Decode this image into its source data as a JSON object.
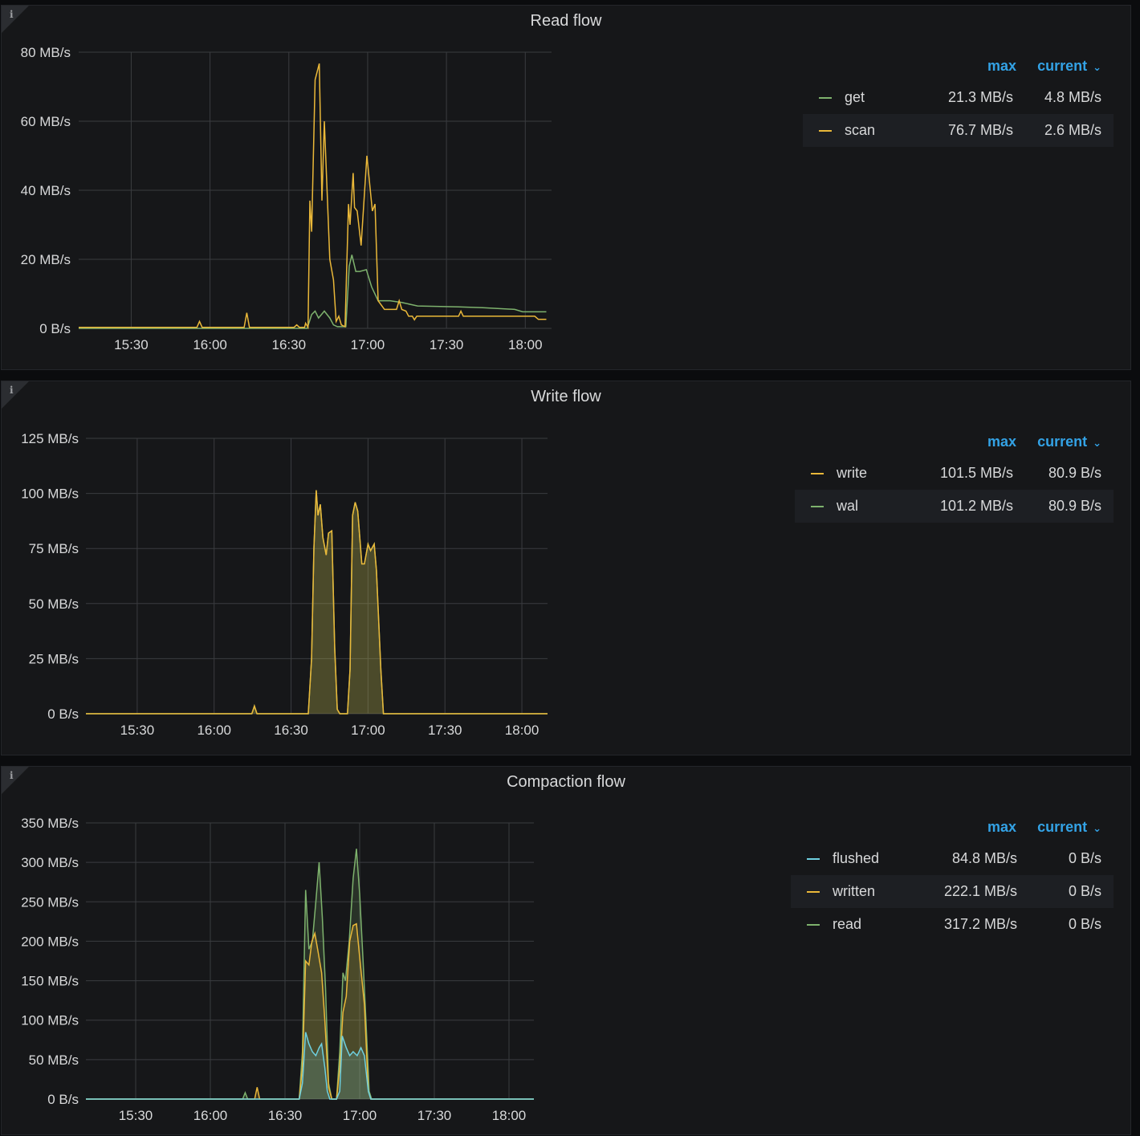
{
  "x_unit": "minutes since 15:00",
  "colors": {
    "green": "#7eb26d",
    "yellow": "#eab839",
    "cyan": "#6ed0e0",
    "accent": "#33a2e5"
  },
  "legend_headers": {
    "max": "max",
    "current": "current"
  },
  "panels": [
    {
      "title": "Read flow",
      "info_icon": "i",
      "legend": [
        {
          "name": "get",
          "max": "21.3 MB/s",
          "current": "4.8 MB/s",
          "color": "#7eb26d"
        },
        {
          "name": "scan",
          "max": "76.7 MB/s",
          "current": "2.6 MB/s",
          "color": "#eab839"
        }
      ]
    },
    {
      "title": "Write flow",
      "info_icon": "i",
      "legend": [
        {
          "name": "write",
          "max": "101.5 MB/s",
          "current": "80.9 B/s",
          "color": "#eab839"
        },
        {
          "name": "wal",
          "max": "101.2 MB/s",
          "current": "80.9 B/s",
          "color": "#7eb26d"
        }
      ]
    },
    {
      "title": "Compaction flow",
      "info_icon": "i",
      "legend": [
        {
          "name": "flushed",
          "max": "84.8 MB/s",
          "current": "0 B/s",
          "color": "#6ed0e0"
        },
        {
          "name": "written",
          "max": "222.1 MB/s",
          "current": "0 B/s",
          "color": "#eab839"
        },
        {
          "name": "read",
          "max": "317.2 MB/s",
          "current": "0 B/s",
          "color": "#7eb26d"
        }
      ]
    }
  ],
  "chart_data": [
    {
      "type": "line",
      "title": "Read flow",
      "xlim": [
        10,
        190
      ],
      "ylim": [
        0,
        80
      ],
      "xticks": [
        30,
        60,
        90,
        120,
        150,
        180
      ],
      "xtick_labels": [
        "15:30",
        "16:00",
        "16:30",
        "17:00",
        "17:30",
        "18:00"
      ],
      "yticks": [
        0,
        20,
        40,
        60,
        80
      ],
      "ytick_labels": [
        "0 B/s",
        "20 MB/s",
        "40 MB/s",
        "60 MB/s",
        "80 MB/s"
      ],
      "fill": false,
      "series": [
        {
          "name": "get",
          "color": "#7eb26d",
          "x": [
            10,
            97,
            98.7,
            100,
            101.3,
            103.5,
            105.6,
            107,
            108.5,
            111.7,
            113,
            114,
            115.5,
            117,
            119.5,
            121.5,
            124,
            128.5,
            133,
            139,
            154.6,
            163.8,
            176,
            179,
            188
          ],
          "y": [
            0,
            0,
            4,
            5,
            3,
            5,
            3,
            1,
            0.5,
            0.5,
            18,
            21.3,
            16.5,
            16.5,
            17,
            12,
            8,
            8,
            7.5,
            6.5,
            6.2,
            6,
            5.5,
            4.8,
            4.8
          ]
        },
        {
          "name": "scan",
          "color": "#eab839",
          "x": [
            10,
            55,
            56,
            57,
            73,
            74,
            75,
            92,
            93,
            94,
            96,
            96.4,
            97.3,
            98,
            98.7,
            100,
            101.6,
            102.6,
            103.5,
            105.6,
            107,
            108,
            109,
            110,
            111.4,
            112.7,
            113.3,
            114.5,
            115,
            116,
            117.5,
            119.7,
            121.8,
            122.8,
            124,
            126.4,
            131,
            132,
            133,
            134.6,
            135.6,
            137,
            137.8,
            138.7,
            154.6,
            155.5,
            156.4,
            183.6,
            185,
            188
          ],
          "y": [
            0.3,
            0.3,
            2,
            0.3,
            0.3,
            4.5,
            0.3,
            0.3,
            1,
            0.3,
            0.3,
            1.5,
            0.3,
            37,
            28,
            72,
            76.7,
            37,
            60,
            20,
            14,
            2,
            3.5,
            1,
            0.5,
            36,
            30,
            45,
            35,
            34,
            24,
            50,
            34,
            36,
            8,
            5.5,
            5.5,
            8,
            5.5,
            5,
            3.5,
            3.5,
            2.5,
            3.5,
            3.5,
            5,
            3.5,
            3.5,
            2.6,
            2.6
          ]
        }
      ]
    },
    {
      "type": "area",
      "title": "Write flow",
      "xlim": [
        10,
        190
      ],
      "ylim": [
        0,
        125
      ],
      "xticks": [
        30,
        60,
        90,
        120,
        150,
        180
      ],
      "xtick_labels": [
        "15:30",
        "16:00",
        "16:30",
        "17:00",
        "17:30",
        "18:00"
      ],
      "yticks": [
        0,
        25,
        50,
        75,
        100,
        125
      ],
      "ytick_labels": [
        "0 B/s",
        "25 MB/s",
        "50 MB/s",
        "75 MB/s",
        "100 MB/s",
        "125 MB/s"
      ],
      "fill": true,
      "series": [
        {
          "name": "wal",
          "color": "#7eb26d",
          "x": [
            10,
            74.7,
            75.7,
            76.7,
            96.7,
            98,
            98.9,
            99.8,
            100.5,
            101.4,
            102.4,
            103.7,
            104.6,
            105.9,
            107,
            108,
            109,
            112,
            113,
            114,
            115,
            116,
            117.6,
            118.6,
            120,
            121,
            122.4,
            123.3,
            125,
            126,
            190
          ],
          "y": [
            0,
            0,
            3.5,
            0,
            0,
            25,
            75,
            101.2,
            90,
            95,
            80,
            72,
            82,
            83,
            30,
            2,
            0,
            0,
            20,
            90,
            96,
            92,
            68,
            68,
            77,
            74,
            77,
            65,
            20,
            0,
            0
          ]
        },
        {
          "name": "write",
          "color": "#eab839",
          "x": [
            10,
            74.7,
            75.7,
            76.7,
            96.7,
            98,
            98.9,
            99.8,
            100.5,
            101.4,
            102.4,
            103.7,
            104.6,
            105.9,
            107,
            108,
            109,
            112,
            113,
            114,
            115,
            116,
            117.6,
            118.6,
            120,
            121,
            122.4,
            123.3,
            125,
            126,
            190
          ],
          "y": [
            0,
            0,
            3.5,
            0,
            0,
            25,
            75,
            101.5,
            90,
            95,
            80,
            72,
            82,
            83,
            30,
            2,
            0,
            0,
            20,
            90,
            96,
            92,
            68,
            68,
            77,
            74,
            77,
            65,
            20,
            0,
            0
          ]
        }
      ]
    },
    {
      "type": "area",
      "title": "Compaction flow",
      "xlim": [
        10,
        190
      ],
      "ylim": [
        0,
        350
      ],
      "xticks": [
        30,
        60,
        90,
        120,
        150,
        180
      ],
      "xtick_labels": [
        "15:30",
        "16:00",
        "16:30",
        "17:00",
        "17:30",
        "18:00"
      ],
      "yticks": [
        0,
        50,
        100,
        150,
        200,
        250,
        300,
        350
      ],
      "ytick_labels": [
        "0 B/s",
        "50 MB/s",
        "100 MB/s",
        "150 MB/s",
        "200 MB/s",
        "250 MB/s",
        "300 MB/s",
        "350 MB/s"
      ],
      "fill": true,
      "series": [
        {
          "name": "read",
          "color": "#7eb26d",
          "x": [
            10,
            73,
            74,
            75,
            95.7,
            97,
            98.3,
            99.6,
            101,
            102.4,
            103.7,
            105,
            106.3,
            107.5,
            108.8,
            110.7,
            112,
            113.3,
            114.3,
            115.8,
            117.4,
            118.7,
            120,
            121.3,
            122.5,
            123.8,
            124.8,
            190
          ],
          "y": [
            0,
            0,
            8,
            0,
            0,
            60,
            265,
            190,
            200,
            250,
            300,
            230,
            140,
            20,
            0,
            0,
            60,
            160,
            150,
            200,
            280,
            317.2,
            260,
            180,
            100,
            10,
            0,
            0
          ]
        },
        {
          "name": "written",
          "color": "#eab839",
          "x": [
            10,
            77.8,
            78.8,
            79.8,
            95.7,
            97,
            98.3,
            99.6,
            100.8,
            102,
            103.4,
            104.7,
            106,
            107.5,
            108.8,
            110.7,
            112,
            113.3,
            114.6,
            116,
            117.4,
            118.7,
            120,
            121.9,
            123.5,
            124.5,
            190
          ],
          "y": [
            0,
            0,
            15,
            0,
            0,
            40,
            175,
            170,
            200,
            210,
            185,
            160,
            100,
            15,
            0,
            0,
            40,
            110,
            130,
            200,
            220,
            222.1,
            180,
            120,
            10,
            0,
            0
          ]
        },
        {
          "name": "flushed",
          "color": "#6ed0e0",
          "x": [
            10,
            95.7,
            97,
            98.3,
            99.6,
            101,
            102.4,
            103.7,
            104.7,
            106,
            107,
            108,
            110.7,
            112,
            113,
            114.6,
            116,
            117.4,
            119,
            120.5,
            121.9,
            123.5,
            124.5,
            190
          ],
          "y": [
            0,
            0,
            20,
            84.8,
            70,
            60,
            55,
            65,
            70,
            40,
            10,
            0,
            0,
            10,
            80,
            65,
            55,
            60,
            55,
            65,
            55,
            10,
            0,
            0
          ]
        }
      ]
    }
  ]
}
